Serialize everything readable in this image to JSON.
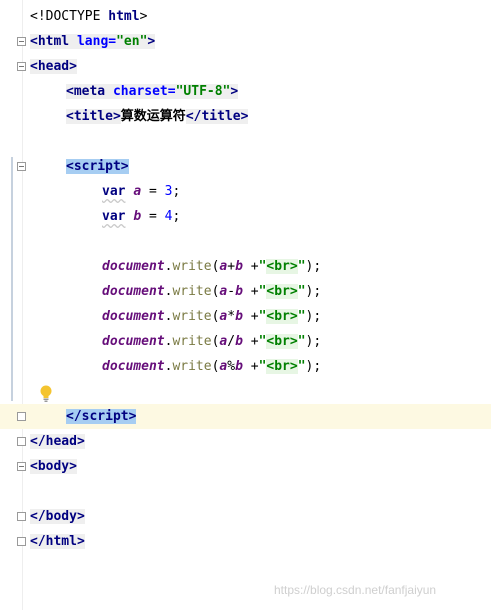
{
  "lines": {
    "doctype": {
      "prefix": "<!DOCTYPE ",
      "name": "html",
      "suffix": ">"
    },
    "html_open": {
      "open": "<",
      "tag": "html",
      "attr": " lang",
      "eq": "=",
      "value": "\"en\"",
      "close": ">"
    },
    "head_open": {
      "open": "<",
      "tag": "head",
      "close": ">"
    },
    "meta": {
      "open": "<",
      "tag": "meta",
      "attr": " charset",
      "eq": "=",
      "value": "\"UTF-8\"",
      "close": ">"
    },
    "title": {
      "open": "<",
      "tag": "title",
      "close": ">",
      "text": "算数运算符",
      "end_open": "</",
      "end_tag": "title",
      "end_close": ">"
    },
    "script_open": {
      "open": "<",
      "tag": "script",
      "close": ">"
    },
    "var_a": {
      "kw": "var",
      "name": "a",
      "op": " = ",
      "num": "3",
      "end": ";"
    },
    "var_b": {
      "kw": "var",
      "name": "b",
      "op": " = ",
      "num": "4",
      "end": ";"
    },
    "writes": [
      {
        "obj": "document",
        "dot": ".",
        "method": "write",
        "lp": "(",
        "a": "a",
        "op": "+",
        "b": "b",
        "plus": " +",
        "q1": "\"",
        "br": "<br>",
        "q2": "\"",
        "rp": ");"
      },
      {
        "obj": "document",
        "dot": ".",
        "method": "write",
        "lp": "(",
        "a": "a",
        "op": "-",
        "b": "b",
        "plus": " +",
        "q1": "\"",
        "br": "<br>",
        "q2": "\"",
        "rp": ");"
      },
      {
        "obj": "document",
        "dot": ".",
        "method": "write",
        "lp": "(",
        "a": "a",
        "op": "*",
        "b": "b",
        "plus": " +",
        "q1": "\"",
        "br": "<br>",
        "q2": "\"",
        "rp": ");"
      },
      {
        "obj": "document",
        "dot": ".",
        "method": "write",
        "lp": "(",
        "a": "a",
        "op": "/",
        "b": "b",
        "plus": " +",
        "q1": "\"",
        "br": "<br>",
        "q2": "\"",
        "rp": ");"
      },
      {
        "obj": "document",
        "dot": ".",
        "method": "write",
        "lp": "(",
        "a": "a",
        "op": "%",
        "b": "b",
        "plus": " +",
        "q1": "\"",
        "br": "<br>",
        "q2": "\"",
        "rp": ");"
      }
    ],
    "script_close": {
      "open": "</",
      "tag": "script",
      "close": ">"
    },
    "head_close": {
      "open": "</",
      "tag": "head",
      "close": ">"
    },
    "body_open": {
      "open": "<",
      "tag": "body",
      "close": ">"
    },
    "body_close": {
      "open": "</",
      "tag": "body",
      "close": ">"
    },
    "html_close": {
      "open": "</",
      "tag": "html",
      "close": ">"
    }
  },
  "icons": {
    "intention": "lightbulb-icon",
    "fold": "fold-marker-icon"
  },
  "colors": {
    "tag": "#000080",
    "attr": "#0000ff",
    "string": "#008000",
    "variable": "#660e7a",
    "method": "#7a7a43",
    "selection": "#a6cdf2",
    "caret_line": "#fdf9e2"
  },
  "watermark": "https://blog.csdn.net/fanfjaiyun"
}
